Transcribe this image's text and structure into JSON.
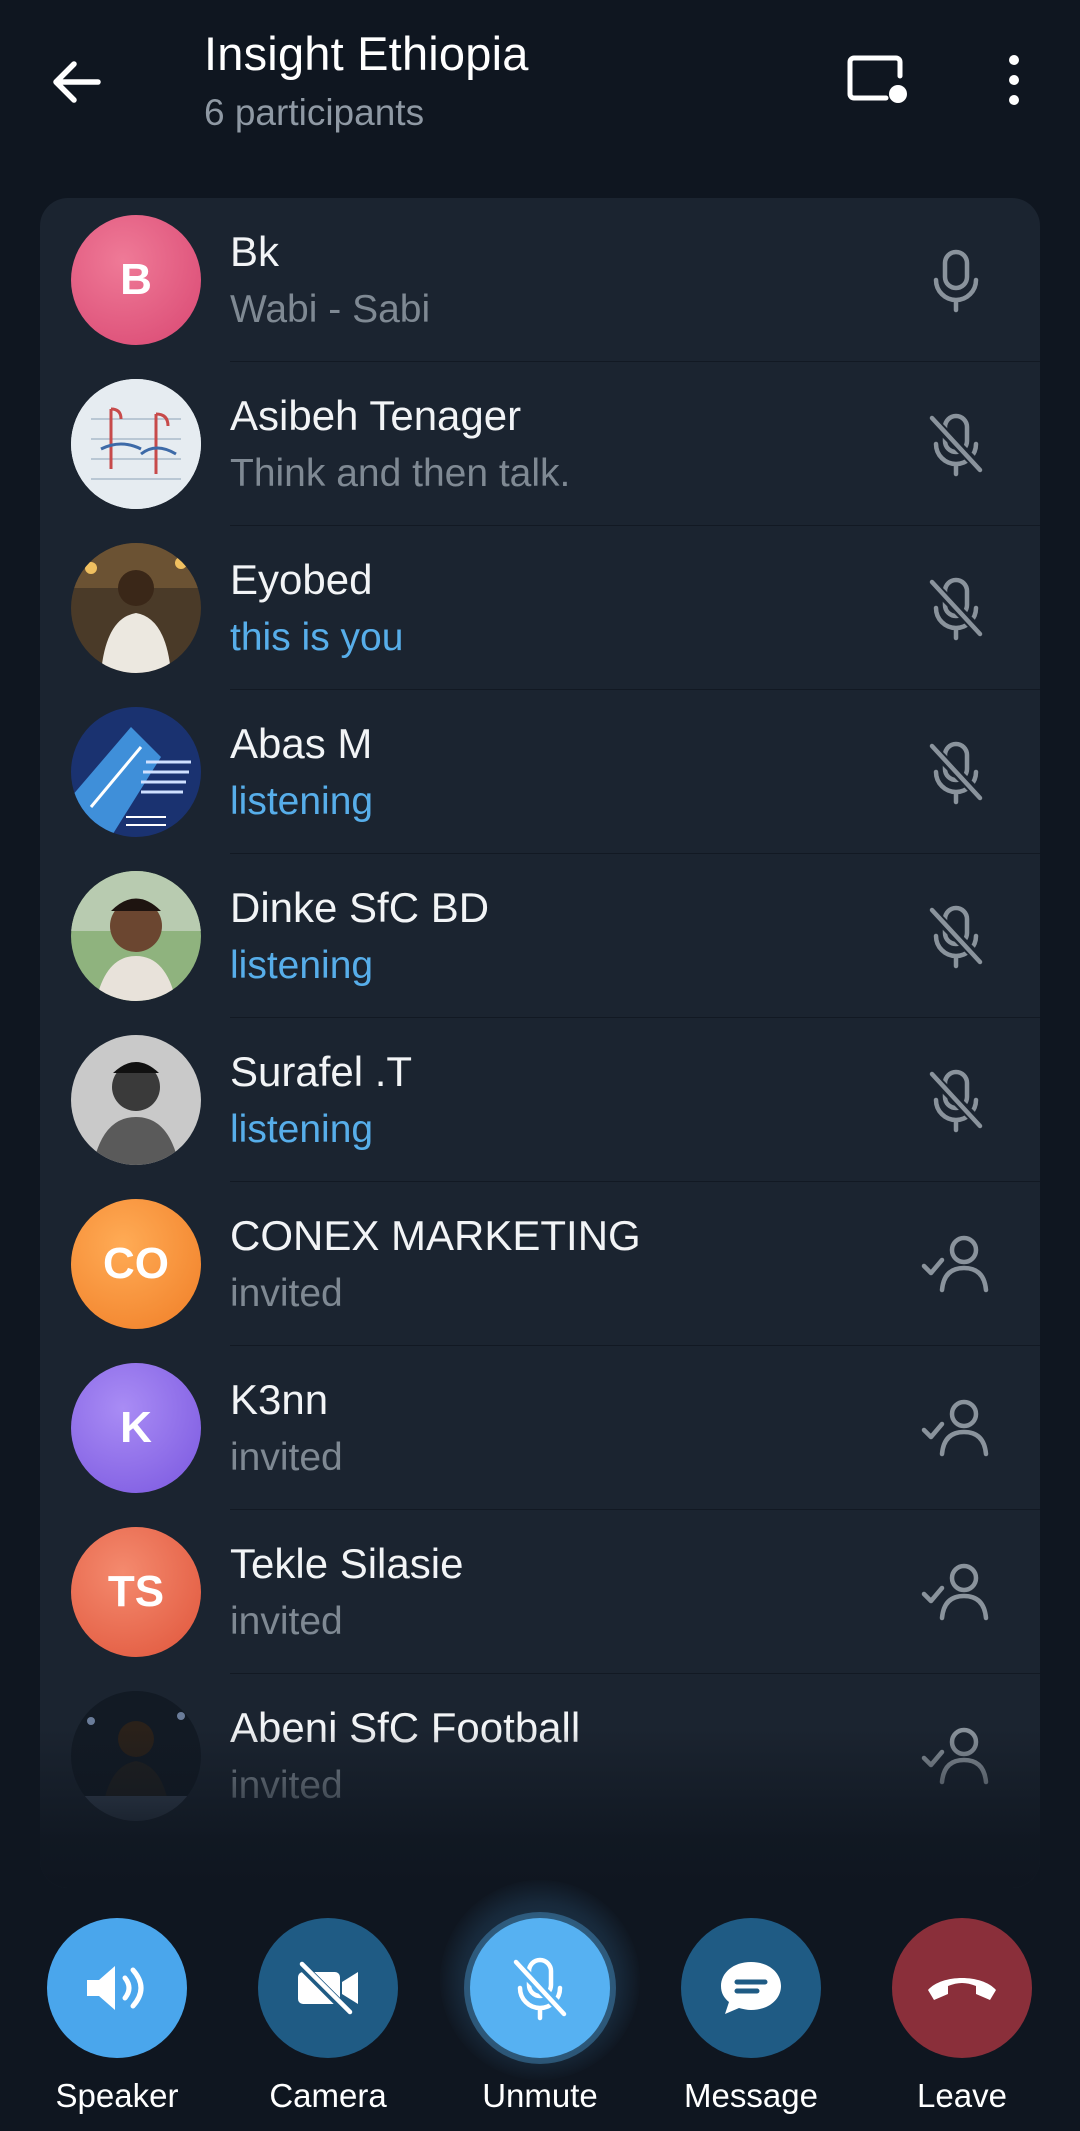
{
  "header": {
    "title": "Insight Ethiopia",
    "subtitle": "6 participants",
    "back_icon": "arrow-left-icon",
    "share_icon": "screen-share-icon",
    "more_icon": "more-vertical-icon"
  },
  "participants": [
    {
      "name": "Bk",
      "status": "Wabi - Sabi",
      "status_color": "grey",
      "avatar_initials": "B",
      "avatar_color": "#e0567c",
      "icon": "microphone-icon"
    },
    {
      "name": "Asibeh Tenager",
      "status": "Think and then talk.",
      "status_color": "grey",
      "avatar_initials": "",
      "avatar_color": "#c9d3dc",
      "icon": "microphone-muted-icon"
    },
    {
      "name": "Eyobed",
      "status": "this is you",
      "status_color": "blue",
      "avatar_initials": "",
      "avatar_color": "#5a4a35",
      "icon": "microphone-muted-icon"
    },
    {
      "name": "Abas M",
      "status": "listening",
      "status_color": "blue",
      "avatar_initials": "",
      "avatar_color": "#1f3f86",
      "icon": "microphone-muted-icon"
    },
    {
      "name": "Dinke SfC BD",
      "status": "listening",
      "status_color": "blue",
      "avatar_initials": "",
      "avatar_color": "#6e8f6a",
      "icon": "microphone-muted-icon"
    },
    {
      "name": "Surafel .T",
      "status": "listening",
      "status_color": "blue",
      "avatar_initials": "",
      "avatar_color": "#9a9a9a",
      "icon": "microphone-muted-icon"
    },
    {
      "name": "CONEX MARKETING",
      "status": "invited",
      "status_color": "grey",
      "avatar_initials": "CO",
      "avatar_color": "#f5913a",
      "icon": "user-invited-icon"
    },
    {
      "name": "K3nn",
      "status": "invited",
      "status_color": "grey",
      "avatar_initials": "K",
      "avatar_color": "#8a6ae6",
      "icon": "user-invited-icon"
    },
    {
      "name": "Tekle Silasie",
      "status": "invited",
      "status_color": "grey",
      "avatar_initials": "TS",
      "avatar_color": "#e8674f",
      "icon": "user-invited-icon"
    },
    {
      "name": "Abeni SfC Football",
      "status": "invited",
      "status_color": "grey",
      "avatar_initials": "",
      "avatar_color": "#1c2430",
      "icon": "user-invited-icon"
    }
  ],
  "controls": [
    {
      "label": "Speaker",
      "icon": "speaker-icon",
      "color": "#4aa6ec"
    },
    {
      "label": "Camera",
      "icon": "camera-off-icon",
      "color": "#1f5b84"
    },
    {
      "label": "Unmute",
      "icon": "microphone-muted-icon",
      "color": "#56b1f2"
    },
    {
      "label": "Message",
      "icon": "message-icon",
      "color": "#1f5b84"
    },
    {
      "label": "Leave",
      "icon": "end-call-icon",
      "color": "#8a2f3a"
    }
  ]
}
